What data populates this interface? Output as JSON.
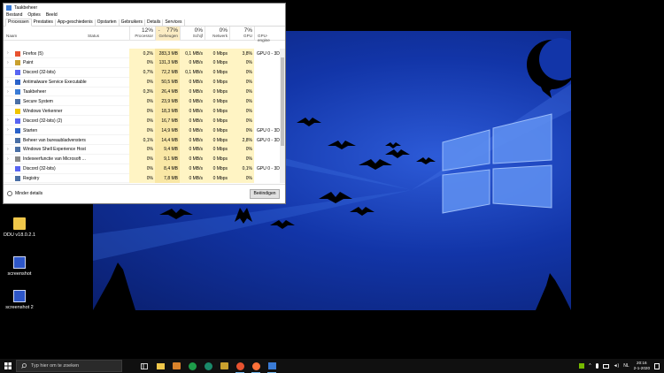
{
  "desktop_icons": [
    {
      "label": "DDU v18.0.2.1"
    },
    {
      "label": "screenshot"
    },
    {
      "label": "screenshot 2"
    }
  ],
  "task_manager": {
    "title": "Taakbeheer",
    "menu": [
      "Bestand",
      "Opties",
      "Beeld"
    ],
    "tabs": [
      "Processen",
      "Prestaties",
      "App-geschiedenis",
      "Opstarten",
      "Gebruikers",
      "Details",
      "Services"
    ],
    "active_tab": "Processen",
    "columns": {
      "name": "Naam",
      "status": "Status",
      "cpu": {
        "pct": "12%",
        "label": "Processor"
      },
      "mem": {
        "pct": "77%",
        "label": "Geheugen"
      },
      "disk": {
        "pct": "0%",
        "label": "Schijf"
      },
      "net": {
        "pct": "0%",
        "label": "Netwerk"
      },
      "gpu": {
        "pct": "7%",
        "label": "GPU"
      },
      "gpu_engine": {
        "label": "GPU-engine"
      }
    },
    "rows": [
      {
        "name": "Firefox (5)",
        "cpu": "0,2%",
        "mem": "283,3 MB",
        "disk": "0,1 MB/s",
        "net": "0 Mbps",
        "gpu": "3,8%",
        "engine": "GPU 0 - 3D",
        "expand": true,
        "icon": "firefox-icon",
        "color": "#e8522f"
      },
      {
        "name": "Paint",
        "cpu": "0%",
        "mem": "131,3 MB",
        "disk": "0 MB/s",
        "net": "0 Mbps",
        "gpu": "0%",
        "engine": "",
        "expand": true,
        "icon": "paint-icon",
        "color": "#c9a02e"
      },
      {
        "name": "Discord (32-bits)",
        "cpu": "0,7%",
        "mem": "72,2 MB",
        "disk": "0,1 MB/s",
        "net": "0 Mbps",
        "gpu": "0%",
        "engine": "",
        "expand": false,
        "icon": "discord-icon",
        "color": "#5865f2"
      },
      {
        "name": "Antimalware Service Executable",
        "cpu": "0%",
        "mem": "50,5 MB",
        "disk": "0 MB/s",
        "net": "0 Mbps",
        "gpu": "0%",
        "engine": "",
        "expand": true,
        "icon": "shield-icon",
        "color": "#2a62c9"
      },
      {
        "name": "Taakbeheer",
        "cpu": "0,3%",
        "mem": "26,4 MB",
        "disk": "0 MB/s",
        "net": "0 Mbps",
        "gpu": "0%",
        "engine": "",
        "expand": true,
        "icon": "taskmanager-icon",
        "color": "#3a7bd5"
      },
      {
        "name": "Secure System",
        "cpu": "0%",
        "mem": "23,9 MB",
        "disk": "0 MB/s",
        "net": "0 Mbps",
        "gpu": "0%",
        "engine": "",
        "expand": false,
        "icon": "system-icon",
        "color": "#4a6fa5"
      },
      {
        "name": "Windows Verkenner",
        "cpu": "0%",
        "mem": "18,3 MB",
        "disk": "0 MB/s",
        "net": "0 Mbps",
        "gpu": "0%",
        "engine": "",
        "expand": false,
        "icon": "folder-icon",
        "color": "#f0c400"
      },
      {
        "name": "Discord (32-bits) (2)",
        "cpu": "0%",
        "mem": "16,7 MB",
        "disk": "0 MB/s",
        "net": "0 Mbps",
        "gpu": "0%",
        "engine": "",
        "expand": true,
        "icon": "discord-icon",
        "color": "#5865f2"
      },
      {
        "name": "Starten",
        "cpu": "0%",
        "mem": "14,9 MB",
        "disk": "0 MB/s",
        "net": "0 Mbps",
        "gpu": "0%",
        "engine": "GPU 0 - 3D",
        "expand": true,
        "icon": "start-icon",
        "color": "#2a62c9"
      },
      {
        "name": "Beheer van bureaubladvensters",
        "cpu": "0,1%",
        "mem": "14,4 MB",
        "disk": "0 MB/s",
        "net": "0 Mbps",
        "gpu": "2,8%",
        "engine": "GPU 0 - 3D",
        "expand": false,
        "icon": "dwm-icon",
        "color": "#4a6fa5"
      },
      {
        "name": "Windows Shell Experience Host",
        "cpu": "0%",
        "mem": "9,4 MB",
        "disk": "0 MB/s",
        "net": "0 Mbps",
        "gpu": "0%",
        "engine": "",
        "expand": true,
        "icon": "shell-icon",
        "color": "#4a6fa5"
      },
      {
        "name": "Indexeerfunctie van Microsoft ...",
        "cpu": "0%",
        "mem": "9,1 MB",
        "disk": "0 MB/s",
        "net": "0 Mbps",
        "gpu": "0%",
        "engine": "",
        "expand": true,
        "icon": "search-index-icon",
        "color": "#888888"
      },
      {
        "name": "Discord (32-bits)",
        "cpu": "0%",
        "mem": "8,4 MB",
        "disk": "0 MB/s",
        "net": "0 Mbps",
        "gpu": "0,1%",
        "engine": "GPU 0 - 3D",
        "expand": false,
        "icon": "discord-icon",
        "color": "#5865f2"
      },
      {
        "name": "Registry",
        "cpu": "0%",
        "mem": "7,8 MB",
        "disk": "0 MB/s",
        "net": "0 Mbps",
        "gpu": "0%",
        "engine": "",
        "expand": false,
        "icon": "registry-icon",
        "color": "#4a6fa5"
      }
    ],
    "footer": {
      "less_details": "Minder details",
      "end_task": "Beëindigen"
    }
  },
  "taskbar": {
    "search_placeholder": "Typ hier om te zoeken",
    "clock_time": "20:16",
    "clock_date": "2-1-2020",
    "language": "NL"
  },
  "colors": {
    "accent": "#76b9ed",
    "wallpaper": "#1235a8"
  }
}
